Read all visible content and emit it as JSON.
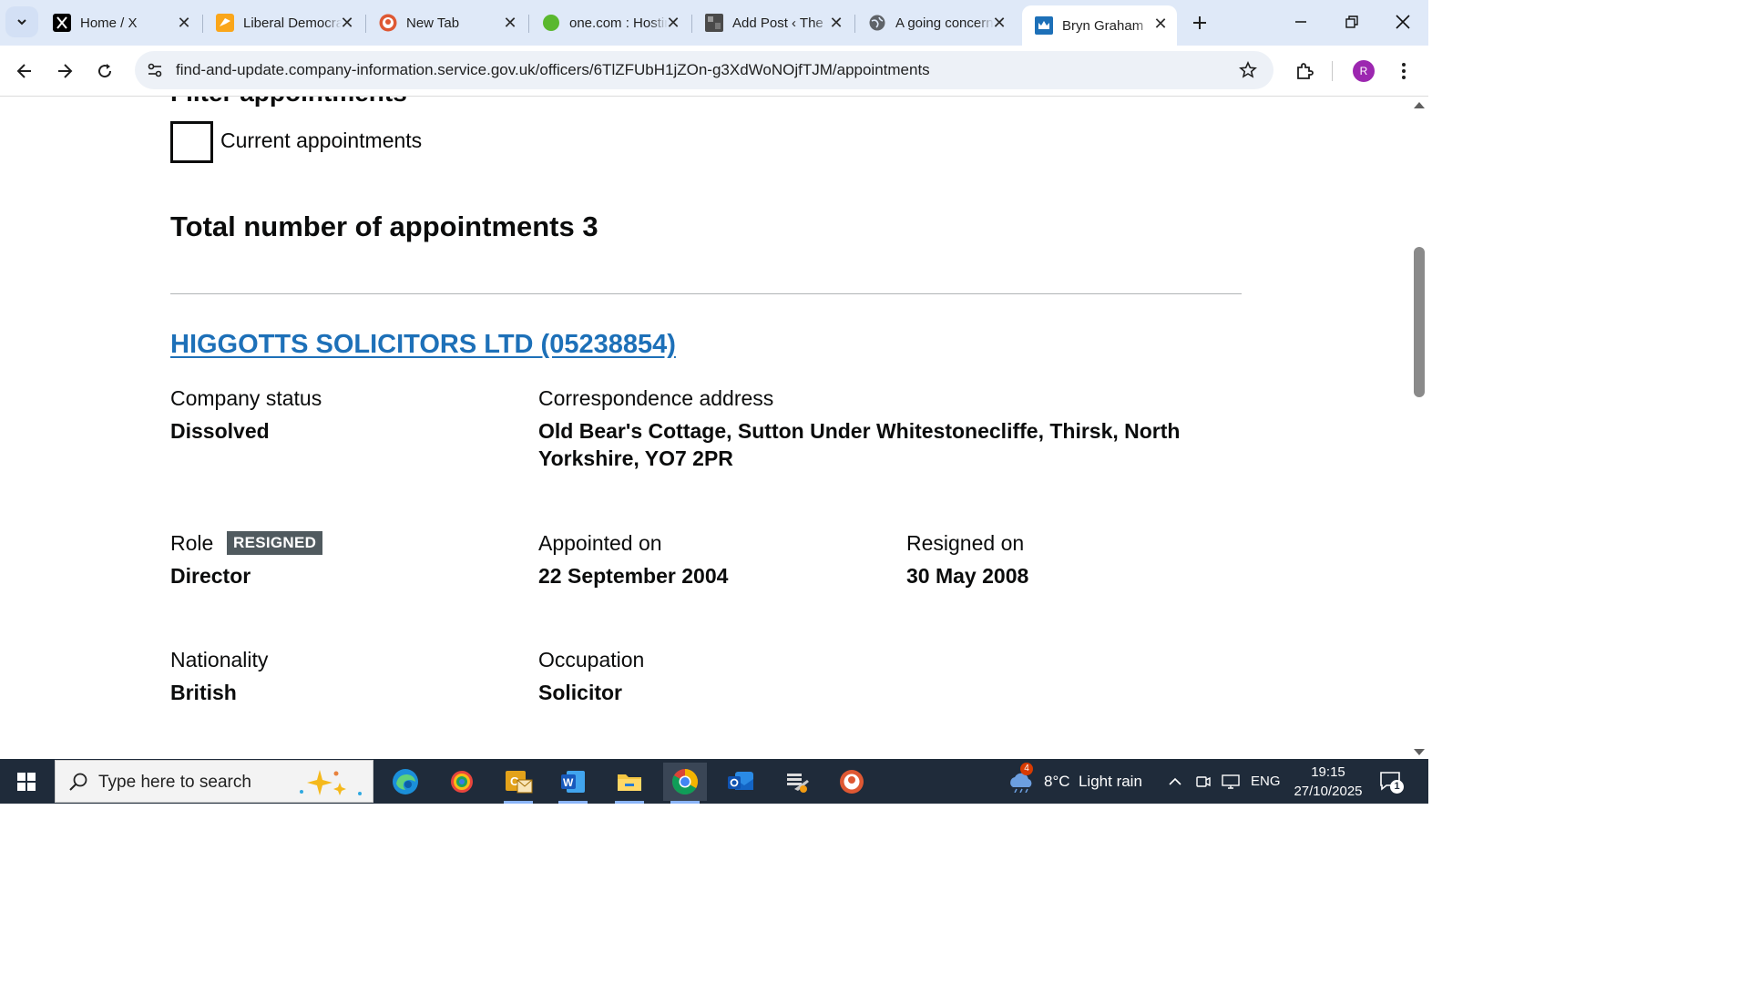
{
  "browser": {
    "tabs": [
      {
        "title": "Home / X",
        "icon": "x-logo-icon"
      },
      {
        "title": "Liberal Democrats",
        "icon": "libdem-bird-icon"
      },
      {
        "title": "New Tab",
        "icon": "duckduckgo-icon"
      },
      {
        "title": "one.com : Hosting",
        "icon": "green-dot-icon"
      },
      {
        "title": "Add Post ‹ The",
        "icon": "site-thumbnail-icon"
      },
      {
        "title": "A going concern",
        "icon": "globe-icon"
      },
      {
        "title": "Bryn Graham",
        "icon": "crown-icon",
        "active": true
      }
    ],
    "url": "find-and-update.company-information.service.gov.uk/officers/6TlZFUbH1jZOn-g3XdWoNOjfTJM/appointments",
    "profile_initial": "R"
  },
  "page": {
    "filter_heading": "Filter appointments",
    "checkbox_label": "Current appointments",
    "total_label": "Total number of appointments 3",
    "appointment": {
      "company_link": "HIGGOTTS SOLICITORS LTD (05238854)",
      "company_status_label": "Company status",
      "company_status_value": "Dissolved",
      "address_label": "Correspondence address",
      "address_line1": "Old Bear's Cottage, Sutton Under Whitestonecliffe, Thirsk, North",
      "address_line2": "Yorkshire, YO7 2PR",
      "role_label": "Role",
      "role_tag": "RESIGNED",
      "role_value": "Director",
      "appointed_label": "Appointed on",
      "appointed_value": "22 September 2004",
      "resigned_label": "Resigned on",
      "resigned_value": "30 May 2008",
      "nationality_label": "Nationality",
      "nationality_value": "British",
      "occupation_label": "Occupation",
      "occupation_value": "Solicitor"
    }
  },
  "taskbar": {
    "search_placeholder": "Type here to search",
    "weather_badge": "4",
    "weather_text": "8°C  Light rain",
    "language": "ENG",
    "time": "19:15",
    "date": "27/10/2025",
    "notification_count": "1"
  },
  "colors": {
    "link": "#1d70b8",
    "tag_bg": "#505a5f",
    "text": "#0b0c0c",
    "tabstrip_bg": "#dfe9f8",
    "taskbar_bg": "#1f2b3a"
  }
}
